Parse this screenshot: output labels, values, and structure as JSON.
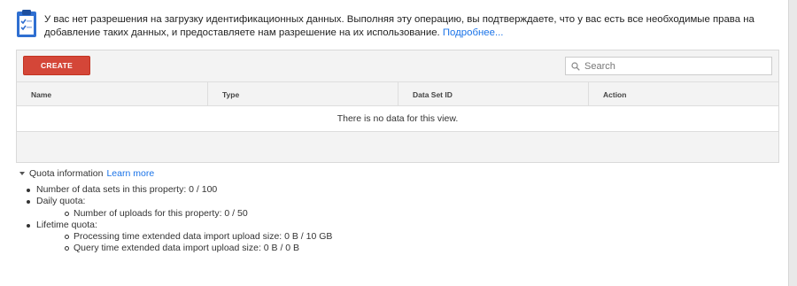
{
  "notice": {
    "icon": "clipboard-check-icon",
    "text": "У вас нет разрешения на загрузку идентификационных данных. Выполняя эту операцию, вы подтверждаете, что у вас есть все необходимые права на добавление таких данных, и предоставляете нам разрешение на их использование. ",
    "link": "Подробнее..."
  },
  "toolbar": {
    "create_label": "CREATE",
    "search_placeholder": "Search",
    "search_icon": "search-icon"
  },
  "table": {
    "columns": [
      "Name",
      "Type",
      "Data Set ID",
      "Action"
    ],
    "empty_message": "There is no data for this view."
  },
  "quota": {
    "title": "Quota information",
    "learn_more": "Learn more",
    "items": [
      "Number of data sets in this property: 0 / 100",
      "Daily quota:",
      "Number of uploads for this property: 0 / 50",
      "Lifetime quota:",
      "Processing time extended data import upload size: 0 B / 10 GB",
      "Query time extended data import upload size: 0 B / 0 B"
    ]
  },
  "colors": {
    "create_button": "#d44638",
    "link": "#1a73e8"
  }
}
